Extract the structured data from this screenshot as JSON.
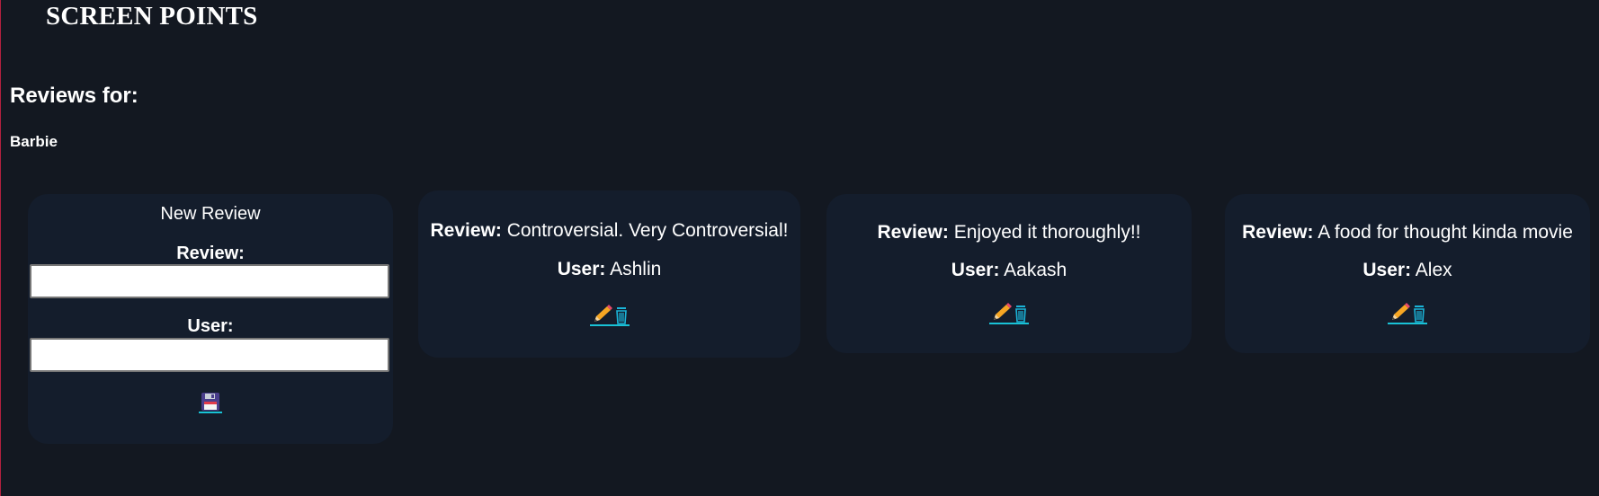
{
  "header": {
    "brand": "SCREEN POINTS"
  },
  "page": {
    "reviews_for_label": "Reviews for:",
    "movie_title": "Barbie"
  },
  "new_review": {
    "title": "New Review",
    "review_label": "Review:",
    "review_value": "",
    "user_label": "User:",
    "user_value": "",
    "save_icon": "floppy-disk-icon"
  },
  "reviews": [
    {
      "review_label": "Review:",
      "review_text": "Controversial. Very Controversial!",
      "user_label": "User:",
      "user_name": "Ashlin"
    },
    {
      "review_label": "Review:",
      "review_text": "Enjoyed it thoroughly!!",
      "user_label": "User:",
      "user_name": "Aakash"
    },
    {
      "review_label": "Review:",
      "review_text": "A food for thought kinda movie",
      "user_label": "User:",
      "user_name": "Alex"
    }
  ],
  "icons": {
    "edit": "pencil-icon",
    "delete": "trash-icon"
  },
  "colors": {
    "background": "#131821",
    "card": "#141d2c",
    "link_underline": "#19c2d6"
  }
}
